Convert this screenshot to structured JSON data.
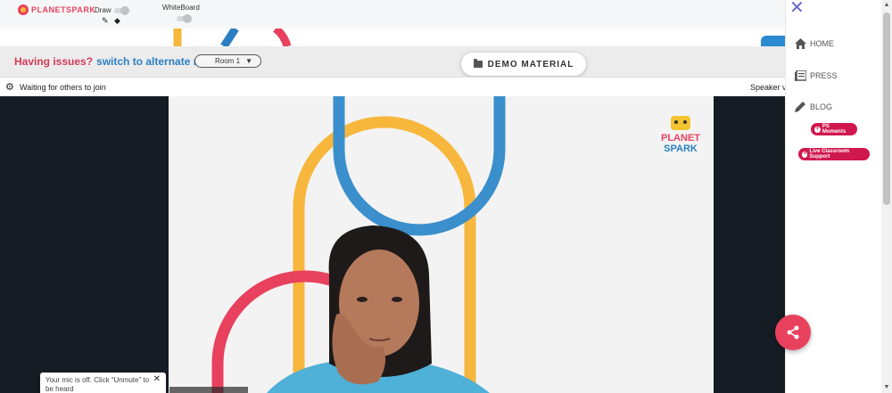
{
  "topbar": {
    "logo_text": "PLANETSPARK",
    "draw_label": "Draw",
    "whiteboard_label": "WhiteBoard"
  },
  "roombar": {
    "issues_question": "Having issues?",
    "alternate_link": "switch to alternate room",
    "room_selected": "Room 1"
  },
  "demo_material": {
    "label": "DEMO MATERIAL"
  },
  "status": {
    "waiting_text": "Waiting for others to join",
    "speaker_view": "Speaker view"
  },
  "stage_logo": {
    "line1": "PLANET",
    "line2": "SPARK"
  },
  "right_panel": {
    "nav": [
      {
        "label": "HOME",
        "icon": "home-icon"
      },
      {
        "label": "PRESS",
        "icon": "press-icon"
      },
      {
        "label": "BLOG",
        "icon": "pencil-icon"
      }
    ],
    "ps_moments": "PS Moments",
    "live_support": "Live Classroom Support"
  },
  "toast": {
    "message": "Your mic is off. Click “Unmute” to be heard"
  },
  "colors": {
    "brand_red": "#e8415e",
    "brand_blue": "#2b7fc1",
    "brand_yellow": "#f6b73c",
    "pill_red": "#d0174e",
    "video_bg": "#151c24"
  }
}
